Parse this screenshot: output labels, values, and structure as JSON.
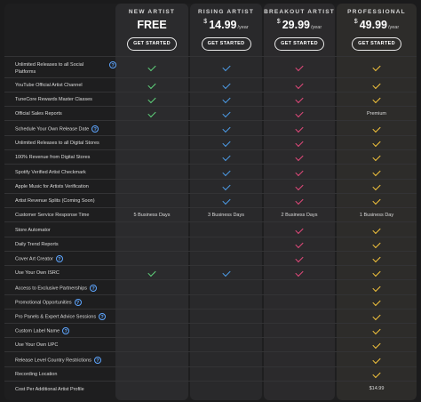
{
  "plans": [
    {
      "name": "NEW ARTIST",
      "price": "FREE",
      "currency": "",
      "period": "",
      "button": "GET STARTED",
      "accent": "#5ed07a"
    },
    {
      "name": "RISING ARTIST",
      "price": "14.99",
      "currency": "$",
      "period": "/year",
      "button": "GET STARTED",
      "accent": "#4d9ce8"
    },
    {
      "name": "BREAKOUT ARTIST",
      "price": "29.99",
      "currency": "$",
      "period": "/year",
      "button": "GET STARTED",
      "accent": "#e0487a"
    },
    {
      "name": "PROFESSIONAL",
      "price": "49.99",
      "currency": "$",
      "period": "/year",
      "button": "GET STARTED",
      "accent": "#f2c23c"
    }
  ],
  "features": [
    {
      "label": "Unlimited Releases to all Social Platforms",
      "info": true,
      "cells": [
        "check",
        "check",
        "check",
        "check"
      ]
    },
    {
      "label": "YouTube Official Artist Channel",
      "info": false,
      "cells": [
        "check",
        "check",
        "check",
        "check"
      ]
    },
    {
      "label": "TuneCore Rewards Master Classes",
      "info": false,
      "cells": [
        "check",
        "check",
        "check",
        "check"
      ]
    },
    {
      "label": "Official Sales Reports",
      "info": false,
      "cells": [
        "check",
        "check",
        "check",
        "Premium"
      ]
    },
    {
      "label": "Schedule Your Own Release Date",
      "info": true,
      "cells": [
        "",
        "check",
        "check",
        "check"
      ]
    },
    {
      "label": "Unlimited Releases to all Digital Stores",
      "info": false,
      "cells": [
        "",
        "check",
        "check",
        "check"
      ]
    },
    {
      "label": "100% Revenue from Digital Stores",
      "info": false,
      "cells": [
        "",
        "check",
        "check",
        "check"
      ]
    },
    {
      "label": "Spotify Verified Artist Checkmark",
      "info": false,
      "cells": [
        "",
        "check",
        "check",
        "check"
      ]
    },
    {
      "label": "Apple Music for Artists Verification",
      "info": false,
      "cells": [
        "",
        "check",
        "check",
        "check"
      ]
    },
    {
      "label": "Artist Revenue Splits (Coming Soon)",
      "info": false,
      "cells": [
        "",
        "check",
        "check",
        "check"
      ]
    },
    {
      "label": "Customer Service Response Time",
      "info": false,
      "cells": [
        "5 Business Days",
        "3 Business Days",
        "2 Business Days",
        "1 Business Day"
      ]
    },
    {
      "label": "Store Automator",
      "info": false,
      "cells": [
        "",
        "",
        "check",
        "check"
      ]
    },
    {
      "label": "Daily Trend Reports",
      "info": false,
      "cells": [
        "",
        "",
        "check",
        "check"
      ]
    },
    {
      "label": "Cover Art Creator",
      "info": true,
      "cells": [
        "",
        "",
        "check",
        "check"
      ]
    },
    {
      "label": "Use Your Own ISRC",
      "info": false,
      "cells": [
        "check",
        "check",
        "check",
        "check"
      ]
    },
    {
      "label": "Access to Exclusive Partnerships",
      "info": true,
      "cells": [
        "",
        "",
        "",
        "check"
      ]
    },
    {
      "label": "Promotional Opportunities",
      "info": true,
      "cells": [
        "",
        "",
        "",
        "check"
      ]
    },
    {
      "label": "Pro Panels & Expert Advice Sessions",
      "info": true,
      "cells": [
        "",
        "",
        "",
        "check"
      ]
    },
    {
      "label": "Custom Label Name",
      "info": true,
      "cells": [
        "",
        "",
        "",
        "check"
      ]
    },
    {
      "label": "Use Your Own UPC",
      "info": false,
      "cells": [
        "",
        "",
        "",
        "check"
      ]
    },
    {
      "label": "Release Level Country Restrictions",
      "info": true,
      "cells": [
        "",
        "",
        "",
        "check"
      ]
    },
    {
      "label": "Recording Location",
      "info": false,
      "cells": [
        "",
        "",
        "",
        "check"
      ]
    },
    {
      "label": "Cost Per Additional Artist Profile",
      "info": false,
      "cells": [
        "",
        "",
        "",
        "$14.99"
      ]
    }
  ],
  "colors": {
    "background": "#1e1e1f",
    "green": "#5ed07a",
    "blue": "#4d9ce8",
    "pink": "#e0487a",
    "gold": "#f2c23c"
  }
}
